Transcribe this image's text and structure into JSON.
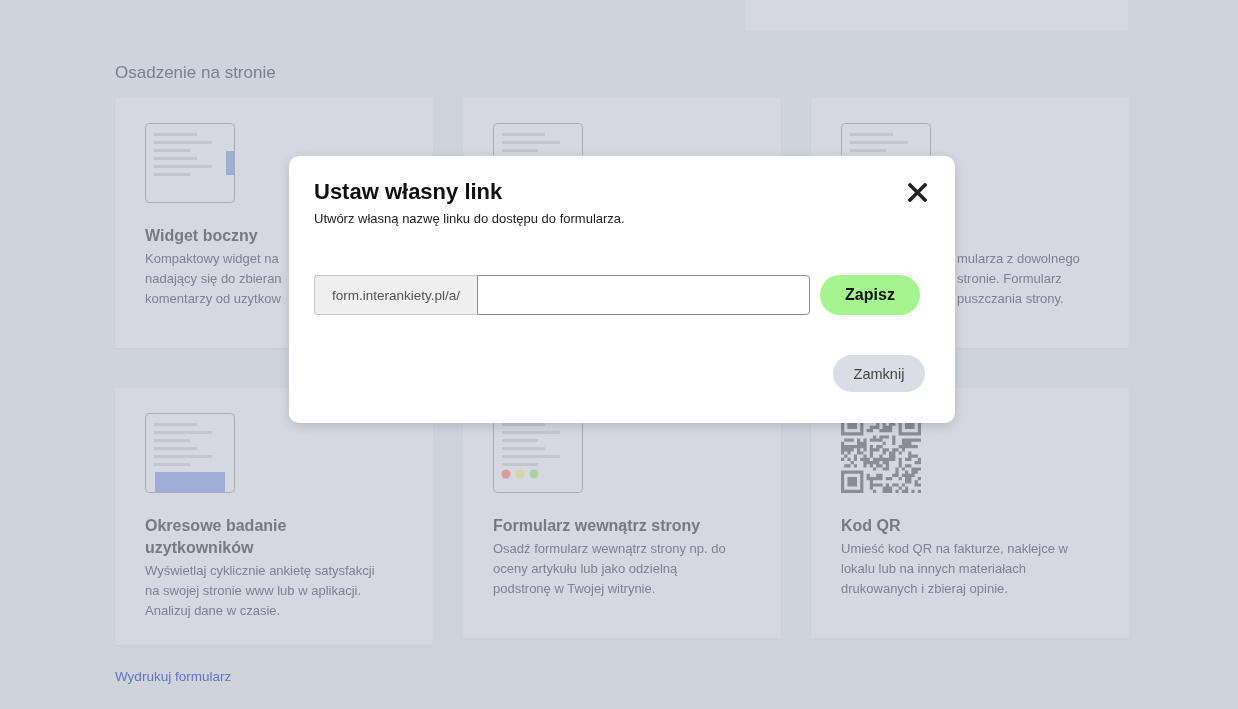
{
  "section": {
    "title": "Osadzenie na stronie"
  },
  "cards": [
    {
      "kind": "sidebar",
      "title": "Widget boczny",
      "description_lines": [
        "Kompaktowy widget na",
        "nadający się do zbieran",
        "komentarzy od uzytkow"
      ]
    },
    {
      "kind": "form"
    },
    {
      "kind": "form",
      "description_lines": [
        "mularza z dowolnego",
        "stronie. Formularz",
        "puszczania strony."
      ]
    },
    {
      "kind": "banner",
      "title": "Okresowe badanie uzytkowników",
      "description": "Wyświetlaj cyklicznie ankietę satysfakcji na swojej stronie www lub w aplikacji. Analizuj dane w czasie."
    },
    {
      "kind": "rating",
      "title": "Formularz wewnątrz strony",
      "description": "Osadź formularz wewnątrz strony np. do oceny artykułu lub jako odzielną podstronę w Twojej witrynie."
    },
    {
      "kind": "qr",
      "title": "Kod QR",
      "description": "Umieść kod QR na fakturze, naklejce w lokalu lub na innych materiałach drukowanych i zbieraj opinie."
    }
  ],
  "print_link": "Wydrukuj formularz",
  "modal": {
    "title": "Ustaw własny link",
    "subtitle": "Utwórz własną nazwę linku do dostępu do formularza.",
    "url_prefix": "form.interankiety.pl/a/",
    "save_button": "Zapisz",
    "close_button": "Zamknij"
  }
}
